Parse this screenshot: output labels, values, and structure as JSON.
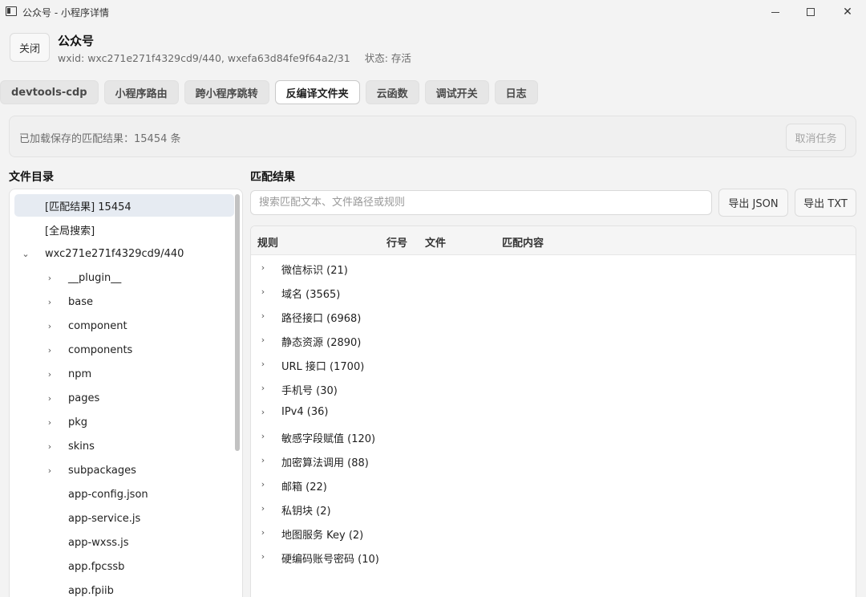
{
  "window": {
    "title": "公众号 - 小程序详情"
  },
  "header": {
    "close_label": "关闭",
    "title": "公众号",
    "subtitle": "wxid: wxc271e271f4329cd9/440, wxefa63d84fe9f64a2/31",
    "status": "状态: 存活"
  },
  "tabs": [
    {
      "label": "devtools-cdp"
    },
    {
      "label": "小程序路由"
    },
    {
      "label": "跨小程序跳转"
    },
    {
      "label": "反编译文件夹",
      "active": true
    },
    {
      "label": "云函数"
    },
    {
      "label": "调试开关"
    },
    {
      "label": "日志"
    }
  ],
  "status_bar": {
    "text": "已加载保存的匹配结果：15454 条",
    "cancel_label": "取消任务"
  },
  "file_tree": {
    "title": "文件目录",
    "items": [
      {
        "label": "[匹配结果] 15454",
        "selected": true
      },
      {
        "label": "[全局搜索]"
      },
      {
        "label": "wxc271e271f4329cd9/440",
        "chevron": "chevron-down"
      },
      {
        "label": "__plugin__",
        "chevron": "chevron-right"
      },
      {
        "label": "base",
        "chevron": "chevron-right"
      },
      {
        "label": "component",
        "chevron": "chevron-right"
      },
      {
        "label": "components",
        "chevron": "chevron-right"
      },
      {
        "label": "npm",
        "chevron": "chevron-right"
      },
      {
        "label": "pages",
        "chevron": "chevron-right"
      },
      {
        "label": "pkg",
        "chevron": "chevron-right"
      },
      {
        "label": "skins",
        "chevron": "chevron-right"
      },
      {
        "label": "subpackages",
        "chevron": "chevron-right"
      },
      {
        "label": "app-config.json"
      },
      {
        "label": "app-service.js"
      },
      {
        "label": "app-wxss.js"
      },
      {
        "label": "app.fpcssb"
      },
      {
        "label": "app.fpiib"
      }
    ]
  },
  "results": {
    "title": "匹配结果",
    "search_placeholder": "搜索匹配文本、文件路径或规则",
    "export_json_label": "导出 JSON",
    "export_txt_label": "导出 TXT",
    "columns": [
      "规则",
      "行号",
      "文件",
      "匹配内容"
    ],
    "groups": [
      {
        "label": "微信标识 (21)"
      },
      {
        "label": "域名 (3565)"
      },
      {
        "label": "路径接口 (6968)"
      },
      {
        "label": "静态资源 (2890)"
      },
      {
        "label": "URL 接口 (1700)"
      },
      {
        "label": "手机号 (30)"
      },
      {
        "label": "IPv4 (36)"
      },
      {
        "label": "敏感字段赋值 (120)"
      },
      {
        "label": "加密算法调用 (88)"
      },
      {
        "label": "邮箱 (22)"
      },
      {
        "label": "私钥块 (2)"
      },
      {
        "label": "地图服务 Key (2)"
      },
      {
        "label": "硬编码账号密码 (10)"
      }
    ]
  }
}
